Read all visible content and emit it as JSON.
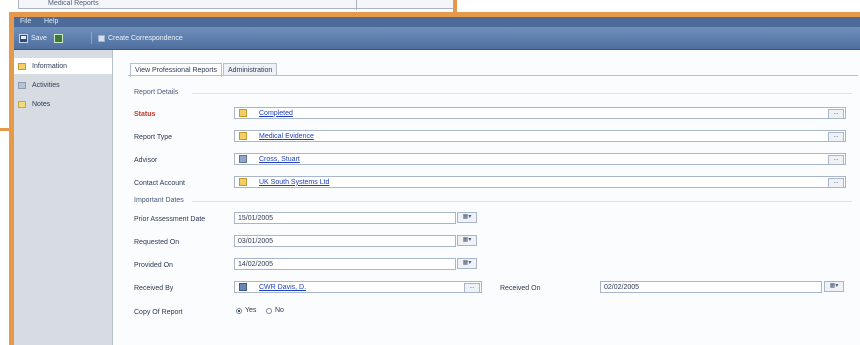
{
  "breadcrumb": {
    "text": "Medical Reports"
  },
  "menubar": {
    "file": "File",
    "help": "Help"
  },
  "toolbar": {
    "save": "Save",
    "save_close_icon": "save-and-close-icon",
    "add_correspondence": "Create Correspondence"
  },
  "leftnav": {
    "items": [
      {
        "label": "Information",
        "icon": "info-icon"
      },
      {
        "label": "Activities",
        "icon": "activities-icon"
      },
      {
        "label": "Notes",
        "icon": "notes-icon"
      }
    ]
  },
  "tabs": [
    {
      "label": "View Professional Reports"
    },
    {
      "label": "Administration"
    }
  ],
  "report_details": {
    "heading": "Report Details",
    "status": {
      "label": "Status",
      "value": "Completed"
    },
    "report_type": {
      "label": "Report Type",
      "value": "Medical Evidence"
    },
    "advisor": {
      "label": "Advisor",
      "value": "Cross, Stuart"
    },
    "contact_account": {
      "label": "Contact Account",
      "value": "UK South Systems Ltd"
    }
  },
  "important_dates": {
    "heading": "Important Dates",
    "first_assessment": {
      "label": "Prior Assessment Date",
      "value": "15/01/2005"
    },
    "requested_on": {
      "label": "Requested On",
      "value": "03/01/2005"
    },
    "provided_on": {
      "label": "Provided On",
      "value": "14/02/2005"
    },
    "received_by": {
      "label": "Received By",
      "value": "CWR Davis, D."
    },
    "received_on": {
      "label": "Received On",
      "value": "02/02/2005"
    },
    "copy_of_report": {
      "label": "Copy Of Report",
      "yes": "Yes",
      "no": "No",
      "selected": "Yes"
    }
  },
  "colors": {
    "accent_frame": "#e49a4a",
    "toolbar": "#5878a8",
    "link": "#1f3fbf",
    "required": "#c0392b"
  }
}
